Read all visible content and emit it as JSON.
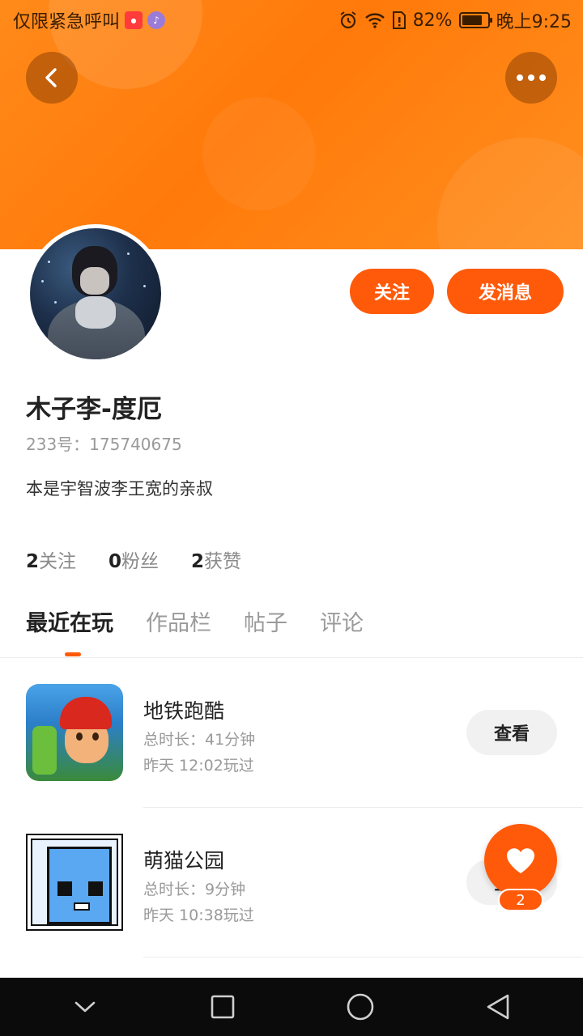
{
  "status_bar": {
    "carrier_text": "仅限紧急呼叫",
    "battery": "82%",
    "battery_level": 0.82,
    "time": "晚上9:25",
    "icons": [
      "app-badge-icon",
      "music-icon",
      "alarm-icon",
      "wifi-icon",
      "sim-icon",
      "battery-icon"
    ]
  },
  "header": {
    "back_icon": "chevron-left-icon",
    "more_icon": "more-dots-icon",
    "banner_color": "#ff7a0a"
  },
  "profile": {
    "name": "木子李-度厄",
    "uid": "233号：175740675",
    "bio": "本是宇智波李王宽的亲叔",
    "follow_label": "关注",
    "message_label": "发消息",
    "accent_color": "#ff5a0a"
  },
  "stats": [
    {
      "num": "2",
      "label": "关注"
    },
    {
      "num": "0",
      "label": "粉丝"
    },
    {
      "num": "2",
      "label": "获赞"
    }
  ],
  "tabs": [
    {
      "label": "最近在玩",
      "active": true
    },
    {
      "label": "作品栏",
      "active": false
    },
    {
      "label": "帖子",
      "active": false
    },
    {
      "label": "评论",
      "active": false
    }
  ],
  "games": [
    {
      "title": "地铁跑酷",
      "duration": "总时长：41分钟",
      "last_played": "昨天 12:02玩过",
      "button": "查看",
      "icon": "subway-surfers-icon"
    },
    {
      "title": "萌猫公园",
      "duration": "总时长：9分钟",
      "last_played": "昨天 10:38玩过",
      "button": "查看",
      "icon": "cat-park-icon"
    }
  ],
  "like_fab": {
    "icon": "heart-icon",
    "count": "2"
  },
  "nav_bar": {
    "icons": [
      "collapse-icon",
      "recents-icon",
      "home-icon",
      "back-triangle-icon"
    ]
  }
}
